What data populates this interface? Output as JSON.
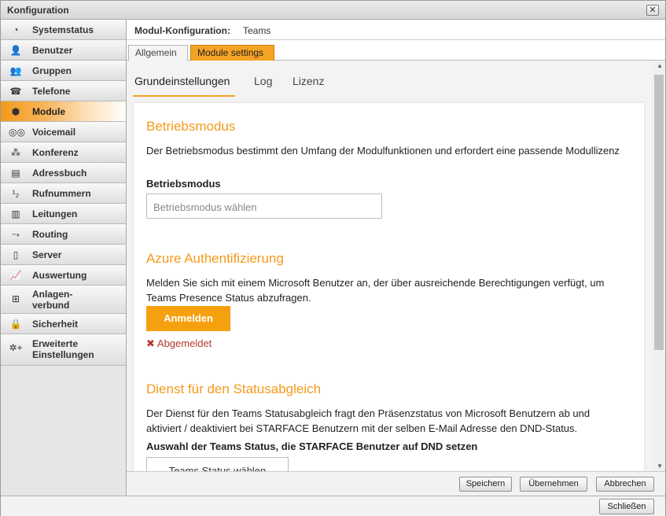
{
  "window": {
    "title": "Konfiguration",
    "close_glyph": "✕"
  },
  "sidebar": {
    "items": [
      {
        "label": "Systemstatus",
        "icon": "status-icon",
        "glyph": "◔"
      },
      {
        "label": "Benutzer",
        "icon": "user-icon",
        "glyph": "👤"
      },
      {
        "label": "Gruppen",
        "icon": "group-icon",
        "glyph": "👥"
      },
      {
        "label": "Telefone",
        "icon": "phone-icon",
        "glyph": "☎"
      },
      {
        "label": "Module",
        "icon": "module-icon",
        "glyph": "⬢"
      },
      {
        "label": "Voicemail",
        "icon": "voicemail-icon",
        "glyph": "◎◎"
      },
      {
        "label": "Konferenz",
        "icon": "conference-icon",
        "glyph": "⁂"
      },
      {
        "label": "Adressbuch",
        "icon": "addressbook-icon",
        "glyph": "▤"
      },
      {
        "label": "Rufnummern",
        "icon": "numbers-icon",
        "glyph": "¹₂"
      },
      {
        "label": "Leitungen",
        "icon": "line-icon",
        "glyph": "▥"
      },
      {
        "label": "Routing",
        "icon": "routing-icon",
        "glyph": "⤳"
      },
      {
        "label": "Server",
        "icon": "server-icon",
        "glyph": "▯"
      },
      {
        "label": "Auswertung",
        "icon": "chart-icon",
        "glyph": "📈"
      },
      {
        "label": "Anlagen-\nverbund",
        "icon": "network-icon",
        "glyph": "⊞"
      },
      {
        "label": "Sicherheit",
        "icon": "lock-icon",
        "glyph": "🔒"
      },
      {
        "label": "Erweiterte\nEinstellungen",
        "icon": "advanced-settings-icon",
        "glyph": "✲+"
      }
    ]
  },
  "header": {
    "label": "Modul-Konfiguration:",
    "value": "Teams"
  },
  "tabs": [
    {
      "label": "Allgemein"
    },
    {
      "label": "Module settings"
    }
  ],
  "subtabs": [
    {
      "label": "Grundeinstellungen"
    },
    {
      "label": "Log"
    },
    {
      "label": "Lizenz"
    }
  ],
  "sections": {
    "betriebsmodus": {
      "title": "Betriebsmodus",
      "text": "Der Betriebsmodus bestimmt den Umfang der Modulfunktionen und erfordert eine passende Modullizenz",
      "label": "Betriebsmodus",
      "select_placeholder": "Betriebsmodus wählen"
    },
    "azure": {
      "title": "Azure Authentifizierung",
      "text": "Melden Sie sich mit einem Microsoft Benutzer an, der über ausreichende Berechtigungen verfügt, um Teams Presence Status abzufragen.",
      "button": "Anmelden",
      "status_glyph": "✖",
      "status": "Abgemeldet"
    },
    "dienst": {
      "title": "Dienst für den Statusabgleich",
      "text": "Der Dienst für den Teams Statusabgleich fragt den Präsenzstatus von Microsoft Benutzern ab und aktiviert / deaktiviert bei STARFACE Benutzern mit der selben E-Mail Adresse den DND-Status.",
      "label": "Auswahl der Teams Status, die STARFACE Benutzer auf DND setzen",
      "select_placeholder": "Teams Status wählen"
    }
  },
  "footer": {
    "save": "Speichern",
    "apply": "Übernehmen",
    "cancel": "Abbrechen"
  },
  "bottom": {
    "close": "Schließen"
  },
  "colors": {
    "accent": "#f5a325",
    "status_error": "#b23a2f"
  }
}
